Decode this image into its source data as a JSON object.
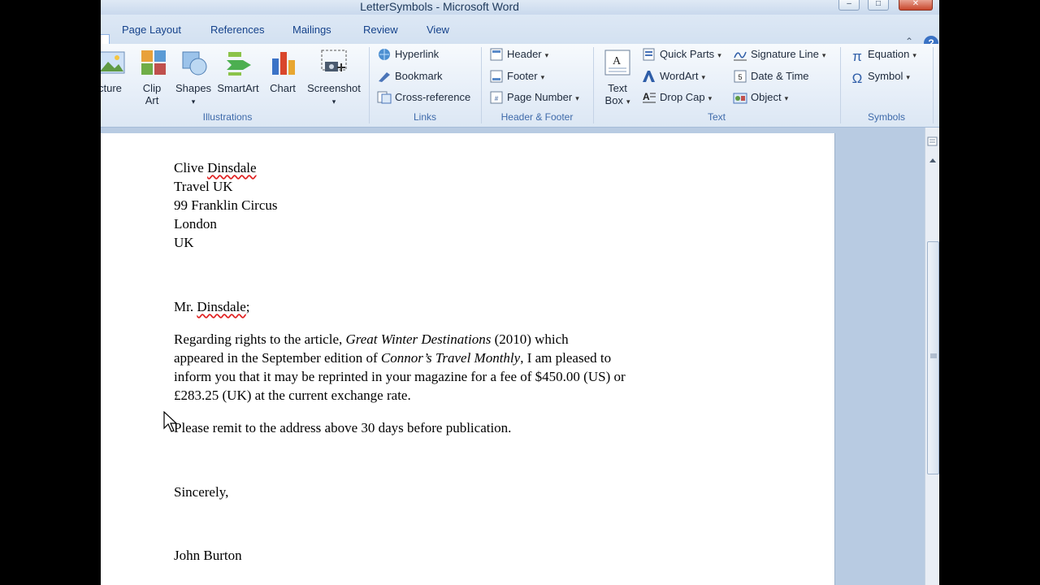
{
  "window": {
    "title": "LetterSymbols  -  Microsoft Word"
  },
  "tabs": [
    "Page Layout",
    "References",
    "Mailings",
    "Review",
    "View"
  ],
  "ribbon": {
    "illustrations": {
      "label": "Illustrations",
      "picture": "icture",
      "clip_art_line1": "Clip",
      "clip_art_line2": "Art",
      "shapes": "Shapes",
      "smartart": "SmartArt",
      "chart": "Chart",
      "screenshot": "Screenshot"
    },
    "links": {
      "label": "Links",
      "hyperlink": "Hyperlink",
      "bookmark": "Bookmark",
      "cross_reference": "Cross-reference"
    },
    "header_footer": {
      "label": "Header & Footer",
      "header": "Header",
      "footer": "Footer",
      "page_number": "Page Number"
    },
    "text": {
      "label": "Text",
      "text_box_line1": "Text",
      "text_box_line2": "Box",
      "quick_parts": "Quick Parts",
      "wordart": "WordArt",
      "drop_cap": "Drop Cap",
      "signature_line": "Signature Line",
      "date_time": "Date & Time",
      "object": "Object"
    },
    "symbols": {
      "label": "Symbols",
      "equation": "Equation",
      "symbol": "Symbol",
      "pi_glyph": "π",
      "omega_glyph": "Ω"
    }
  },
  "document": {
    "address": {
      "first_name": "Clive",
      "last_name": "Dinsdale",
      "company": "Travel UK",
      "street": "99 Franklin Circus",
      "city": "London",
      "country": "UK"
    },
    "salutation": {
      "prefix": "Mr. ",
      "name": "Dinsdale",
      "suffix": ";"
    },
    "body": {
      "l1_a": "Regarding rights to the article, ",
      "l1_b": "Great Winter Destinations",
      "l1_c": " (2010) which",
      "l2_a": "appeared in the September edition of ",
      "l2_b": "Connor’s Travel Monthly",
      "l2_c": ", I am pleased to",
      "l3": "inform you that it may be reprinted in your magazine for a fee of $450.00 (US) or",
      "l4": "£283.25 (UK) at the current exchange rate."
    },
    "remit": "Please remit to the address above 30 days before publication.",
    "closing": "Sincerely,",
    "signature": "John Burton"
  },
  "colors": {
    "ribbon_text": "#15428b",
    "spell_error": "#e02020"
  }
}
